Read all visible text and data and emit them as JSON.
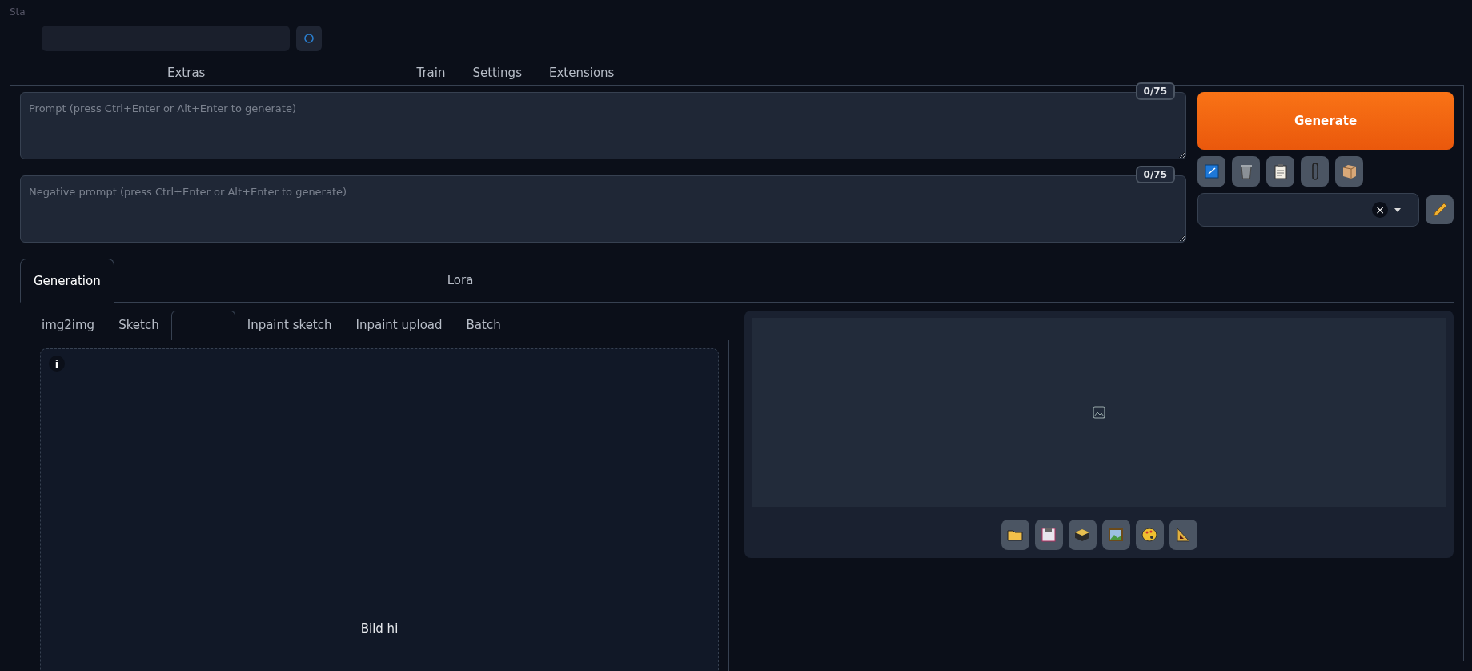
{
  "app_title": "Sta",
  "top_tabs": [
    {
      "label": "Extras",
      "selected": false
    },
    {
      "label": "Train",
      "selected": false
    },
    {
      "label": "Settings",
      "selected": false
    },
    {
      "label": "Extensions",
      "selected": false
    }
  ],
  "prompt": {
    "placeholder": "Prompt (press Ctrl+Enter or Alt+Enter to generate)",
    "token_count": "0/75"
  },
  "negative_prompt": {
    "placeholder": "Negative prompt (press Ctrl+Enter or Alt+Enter to generate)",
    "token_count": "0/75"
  },
  "generate_button": "Generate",
  "style_clear": "×",
  "section_tabs": [
    {
      "label": "Generation",
      "selected": true
    },
    {
      "label": "Lora",
      "selected": false
    }
  ],
  "mode_tabs": [
    {
      "label": "img2img",
      "selected": false
    },
    {
      "label": "Sketch",
      "selected": false
    },
    {
      "selected": true
    },
    {
      "label": "Inpaint sketch",
      "selected": false
    },
    {
      "label": "Inpaint upload",
      "selected": false
    },
    {
      "label": "Batch",
      "selected": false
    }
  ],
  "upload": {
    "info": "i",
    "hint": "Bild hi"
  }
}
